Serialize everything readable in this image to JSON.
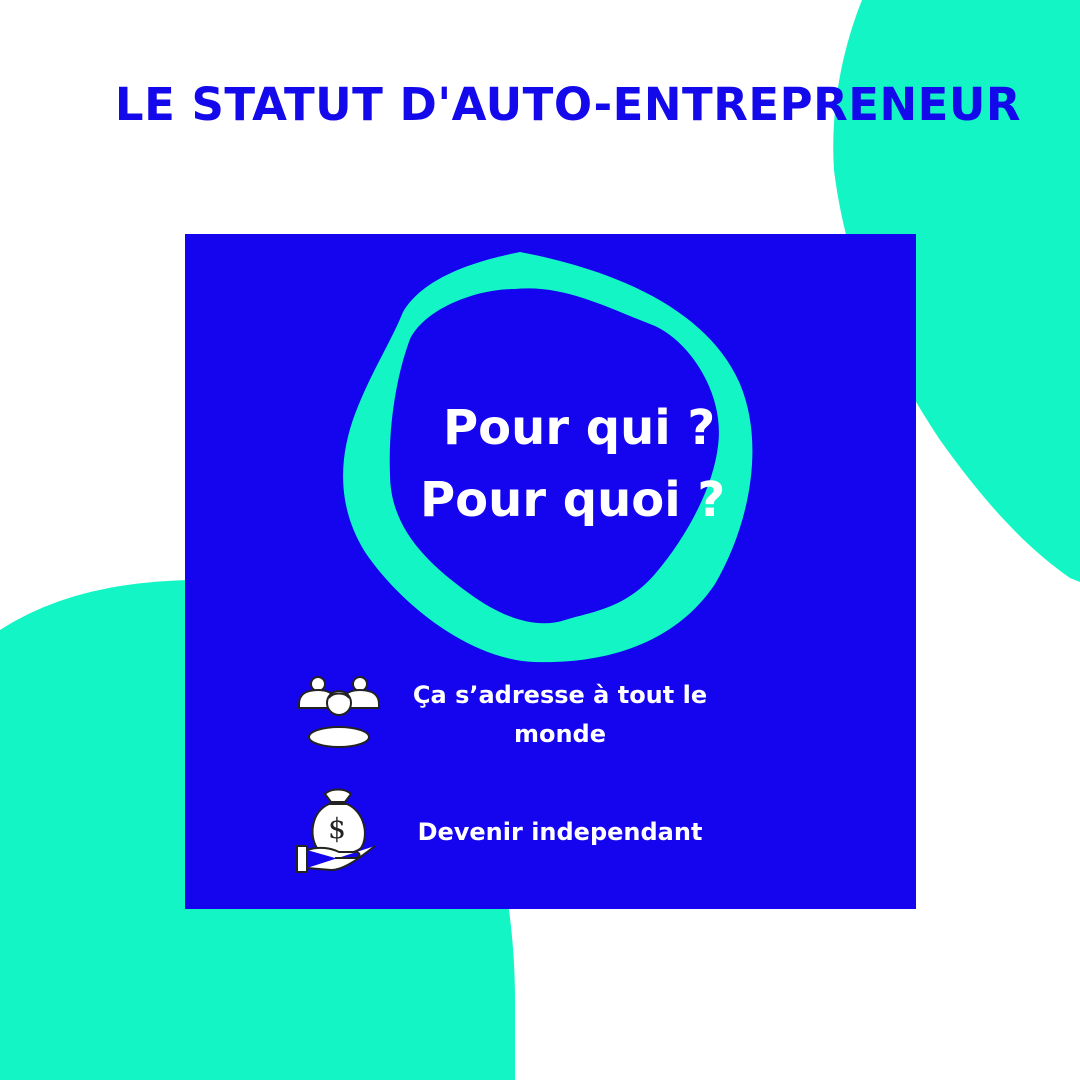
{
  "title": "LE STATUT D'AUTO-ENTREPRENEUR",
  "card": {
    "question_line1": "Pour qui ?",
    "question_line2": "Pour quoi ?",
    "features": [
      {
        "icon": "group-people-icon",
        "text": "Ça s’adresse à tout le monde"
      },
      {
        "icon": "money-bag-hand-icon",
        "text": "Devenir independant"
      }
    ]
  },
  "colors": {
    "background": "#ffffff",
    "accent_mint": "#14f5c6",
    "card_blue": "#1405ee",
    "title_blue": "#1409ea",
    "text_white": "#ffffff"
  }
}
